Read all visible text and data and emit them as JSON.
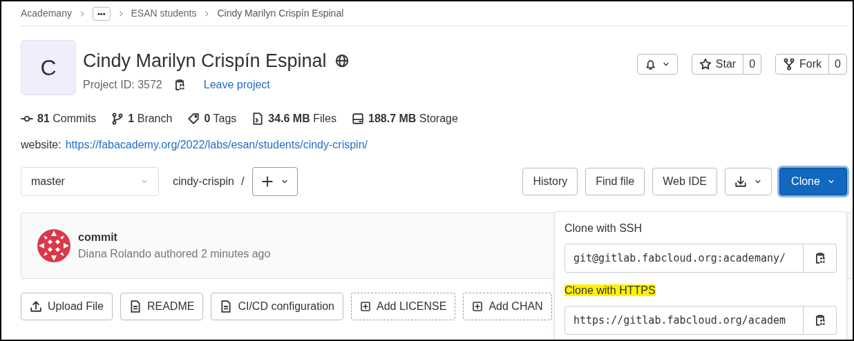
{
  "breadcrumbs": [
    {
      "label": "Academany",
      "kind": "link"
    },
    {
      "label": "•••",
      "kind": "more"
    },
    {
      "label": "ESAN students",
      "kind": "link"
    },
    {
      "label": "Cindy Marilyn Crispín Espinal",
      "kind": "current"
    }
  ],
  "project": {
    "avatar_letter": "C",
    "title": "Cindy Marilyn Crispín Espinal",
    "project_id": "Project ID: 3572",
    "leave_link": "Leave project"
  },
  "actions": [
    {
      "kind": "star",
      "label": "Star",
      "count": "0"
    },
    {
      "kind": "fork",
      "label": "Fork",
      "count": "0"
    }
  ],
  "stats": [
    {
      "kind": "commits",
      "value": "81",
      "label": "Commits"
    },
    {
      "kind": "branch",
      "value": "1",
      "label": "Branch"
    },
    {
      "kind": "tags",
      "value": "0",
      "label": "Tags"
    },
    {
      "kind": "files",
      "value": "34.6 MB",
      "label": "Files"
    },
    {
      "kind": "storage",
      "value": "188.7 MB",
      "label": "Storage"
    }
  ],
  "website": {
    "label": "website:",
    "url": "https://fabacademy.org/2022/labs/esan/students/cindy-crispin/"
  },
  "branch_select": "master",
  "path": "cindy-crispin",
  "path_separator": "/",
  "toolbar": [
    {
      "label": "History"
    },
    {
      "label": "Find file"
    },
    {
      "label": "Web IDE"
    }
  ],
  "clone_button": {
    "label": "Clone",
    "expanded": true
  },
  "last_commit": {
    "title": "commit",
    "meta": "Diana Rolando authored 2 minutes ago"
  },
  "quick_buttons": [
    {
      "kind": "upload",
      "label": "Upload File",
      "dashed": false
    },
    {
      "kind": "file",
      "label": "README",
      "dashed": false
    },
    {
      "kind": "file",
      "label": "CI/CD configuration",
      "dashed": false
    },
    {
      "kind": "add",
      "label": "Add LICENSE",
      "dashed": true
    },
    {
      "kind": "add",
      "label": "Add CHAN",
      "dashed": true
    }
  ],
  "clone_menu": [
    {
      "label": "Clone with SSH",
      "highlighted": false,
      "value": "git@gitlab.fabcloud.org:academany/"
    },
    {
      "label": "Clone with HTTPS",
      "highlighted": true,
      "value": "https://gitlab.fabcloud.org/academ"
    }
  ]
}
